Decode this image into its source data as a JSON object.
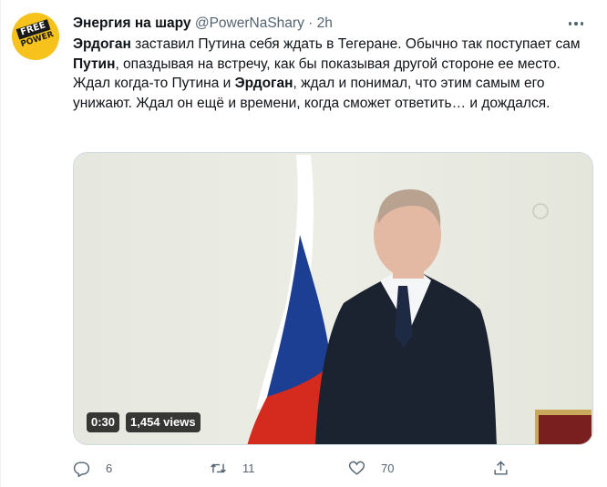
{
  "author": {
    "display_name": "Энергия на шару",
    "handle": "@PowerNaShary",
    "separator": "·",
    "time": "2h",
    "avatar_text_line1": "FREE",
    "avatar_text_line2": "POWER",
    "avatar_color": "#f6c21b"
  },
  "tweet": {
    "segments": [
      {
        "text": "Эрдоган",
        "bold": true
      },
      {
        "text": " заставил Путина себя ждать в Тегеране. Обычно так поступает сам ",
        "bold": false
      },
      {
        "text": "Путин",
        "bold": true
      },
      {
        "text": ", опаздывая на встречу, как бы показывая другой стороне ее место. Ждал когда-то Путина и ",
        "bold": false
      },
      {
        "text": "Эрдоган",
        "bold": true
      },
      {
        "text": ", ждал и понимал, что этим самым его унижают. Ждал он ещё и времени, когда сможет ответить… и дождался.",
        "bold": false
      }
    ]
  },
  "media": {
    "duration": "0:30",
    "views": "1,454 views",
    "flag_colors": [
      "#ffffff",
      "#1c3f94",
      "#d52b1e"
    ]
  },
  "actions": {
    "replies": "6",
    "retweets": "11",
    "likes": "70",
    "reply_icon": "reply-icon",
    "retweet_icon": "retweet-icon",
    "like_icon": "heart-icon",
    "share_icon": "share-icon"
  }
}
